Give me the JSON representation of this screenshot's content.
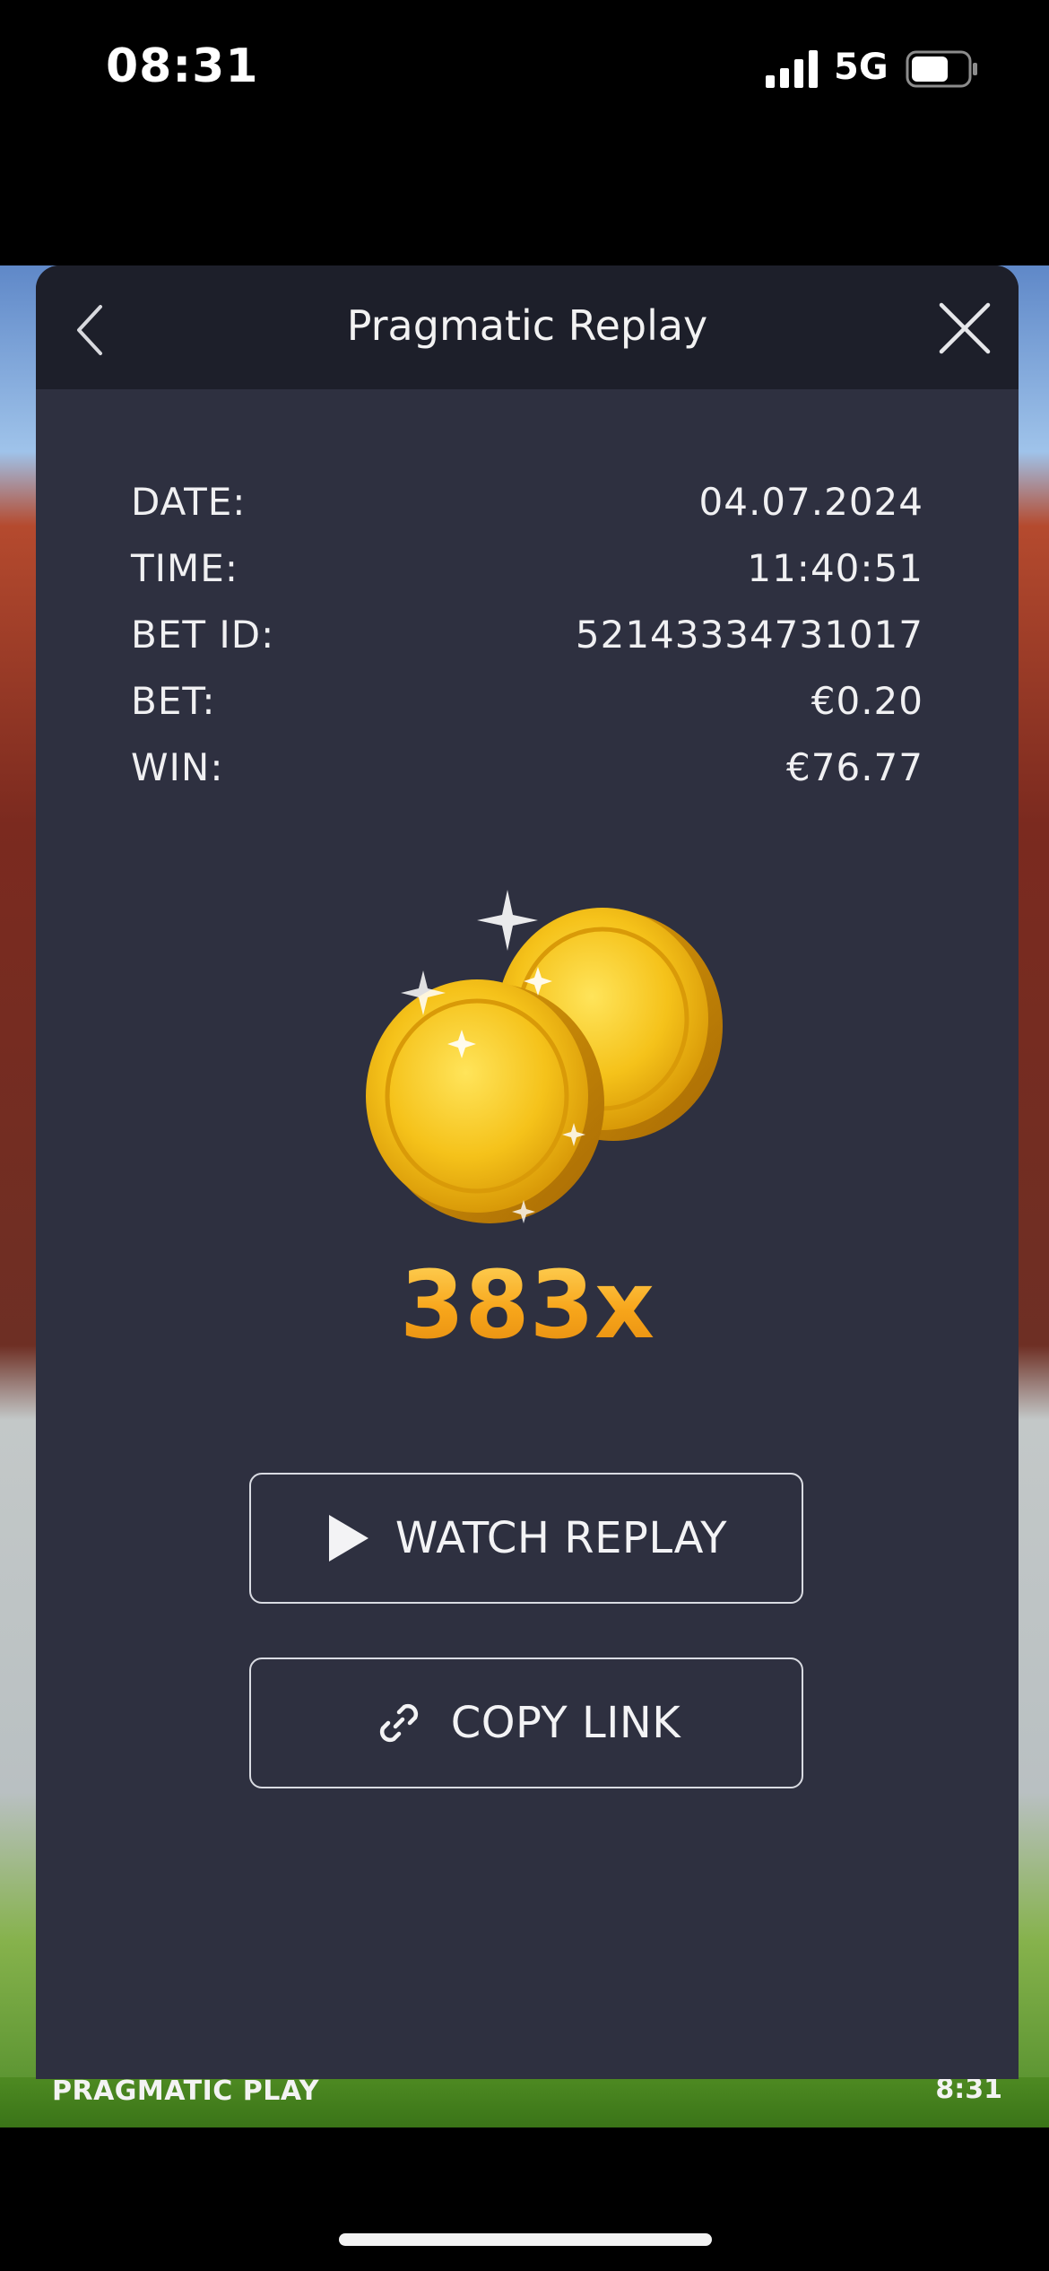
{
  "status_bar": {
    "time": "08:31",
    "network": "5G",
    "signal_icon": "signal-bars-icon",
    "battery_icon": "battery-icon"
  },
  "game": {
    "provider": "PRAGMATIC PLAY",
    "clock": "8:31"
  },
  "modal": {
    "title": "Pragmatic Replay",
    "back_icon": "chevron-left-icon",
    "close_icon": "close-icon",
    "details": [
      {
        "label": "DATE:",
        "value": "04.07.2024"
      },
      {
        "label": "TIME:",
        "value": "11:40:51"
      },
      {
        "label": "BET ID:",
        "value": "52143334731017"
      },
      {
        "label": "BET:",
        "value": "€0.20"
      },
      {
        "label": "WIN:",
        "value": "€76.77"
      }
    ],
    "illustration": "gold-coins-icon",
    "multiplier": "383x",
    "buttons": {
      "watch_replay": "WATCH REPLAY",
      "watch_replay_icon": "play-icon",
      "copy_link": "COPY LINK",
      "copy_link_icon": "link-icon"
    }
  },
  "colors": {
    "modal_bg": "#2e3040",
    "header_bg": "#1d1f2a",
    "multiplier": "#f6a81c"
  }
}
